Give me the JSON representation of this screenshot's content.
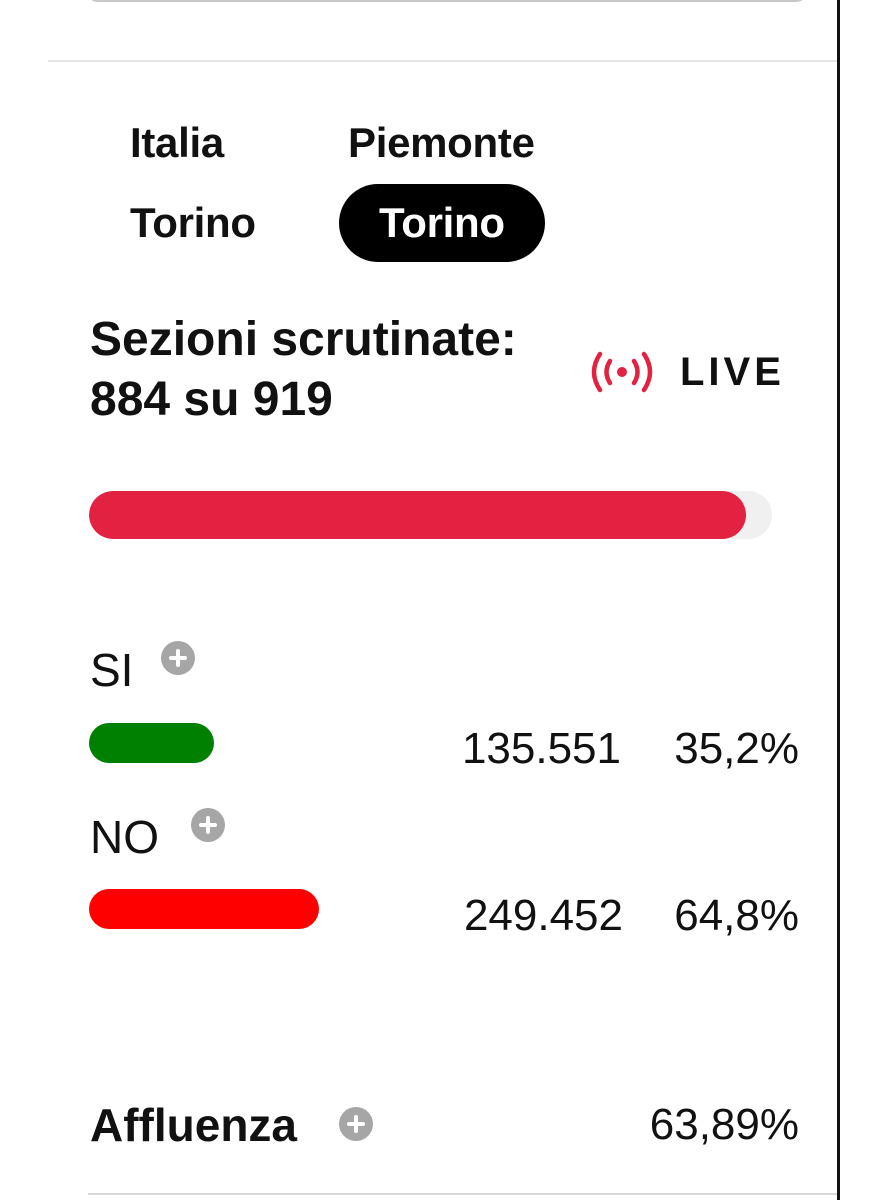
{
  "tabs": {
    "italia": "Italia",
    "piemonte": "Piemonte",
    "torino_provincia": "Torino",
    "torino_comune": "Torino"
  },
  "status": {
    "line1": "Sezioni scrutinate:",
    "line2": "884 su 919",
    "sections_counted": 884,
    "sections_total": 919,
    "live_label": "LIVE",
    "live_icon": "live-broadcast-icon",
    "progress_fraction": 0.962
  },
  "results": {
    "si": {
      "label": "SI",
      "votes": "135.551",
      "percent": "35,2%",
      "percent_value": 35.2,
      "color": "#008000"
    },
    "no": {
      "label": "NO",
      "votes": "249.452",
      "percent": "64,8%",
      "percent_value": 64.8,
      "color": "#ff0000"
    }
  },
  "affluenza": {
    "label": "Affluenza",
    "value": "63,89%"
  },
  "colors": {
    "accent_red": "#e32242",
    "active_tab_bg": "#000000",
    "plus_icon": "#a6a6a6"
  }
}
